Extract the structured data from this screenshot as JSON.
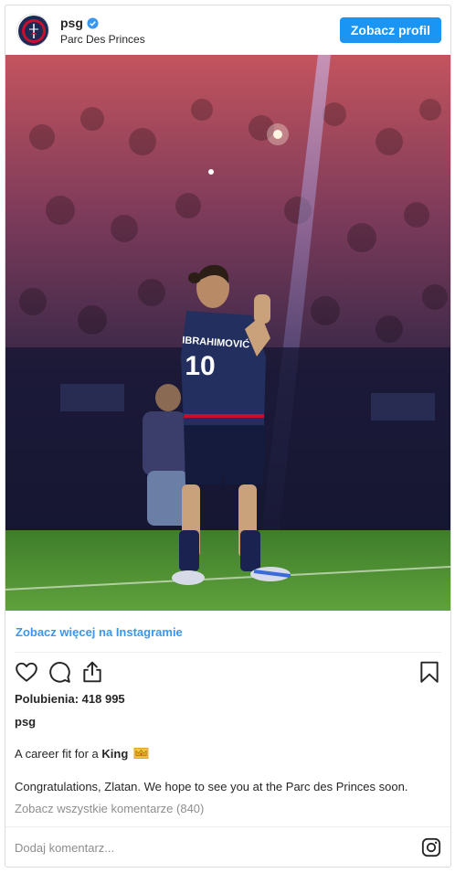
{
  "header": {
    "username": "psg",
    "location": "Parc Des Princes",
    "profile_button": "Zobacz profil",
    "avatar_icon": "psg-crest-icon",
    "verified_icon": "verified-badge-icon"
  },
  "photo": {
    "jersey_name": "IBRAHIMOVIĆ",
    "jersey_number": "10"
  },
  "more_link": "Zobacz więcej na Instagramie",
  "actions": {
    "like_icon": "heart-icon",
    "comment_icon": "comment-icon",
    "share_icon": "share-icon",
    "save_icon": "bookmark-icon"
  },
  "likes": "Polubienia: 418 995",
  "author": "psg",
  "caption": {
    "text": "A career fit for a ",
    "bold": "King",
    "emoji_icon": "crown-emoji-icon"
  },
  "congrats": "Congratulations, Zlatan. We hope to see you at the Parc des Princes soon.",
  "view_comments": "Zobacz wszystkie komentarze (840)",
  "comment_bar": {
    "placeholder": "Dodaj komentarz...",
    "instagram_icon": "instagram-logo-icon"
  },
  "colors": {
    "accent": "#1a95f4",
    "link": "#3897f0",
    "muted": "#8e8e8e",
    "text": "#262626"
  }
}
